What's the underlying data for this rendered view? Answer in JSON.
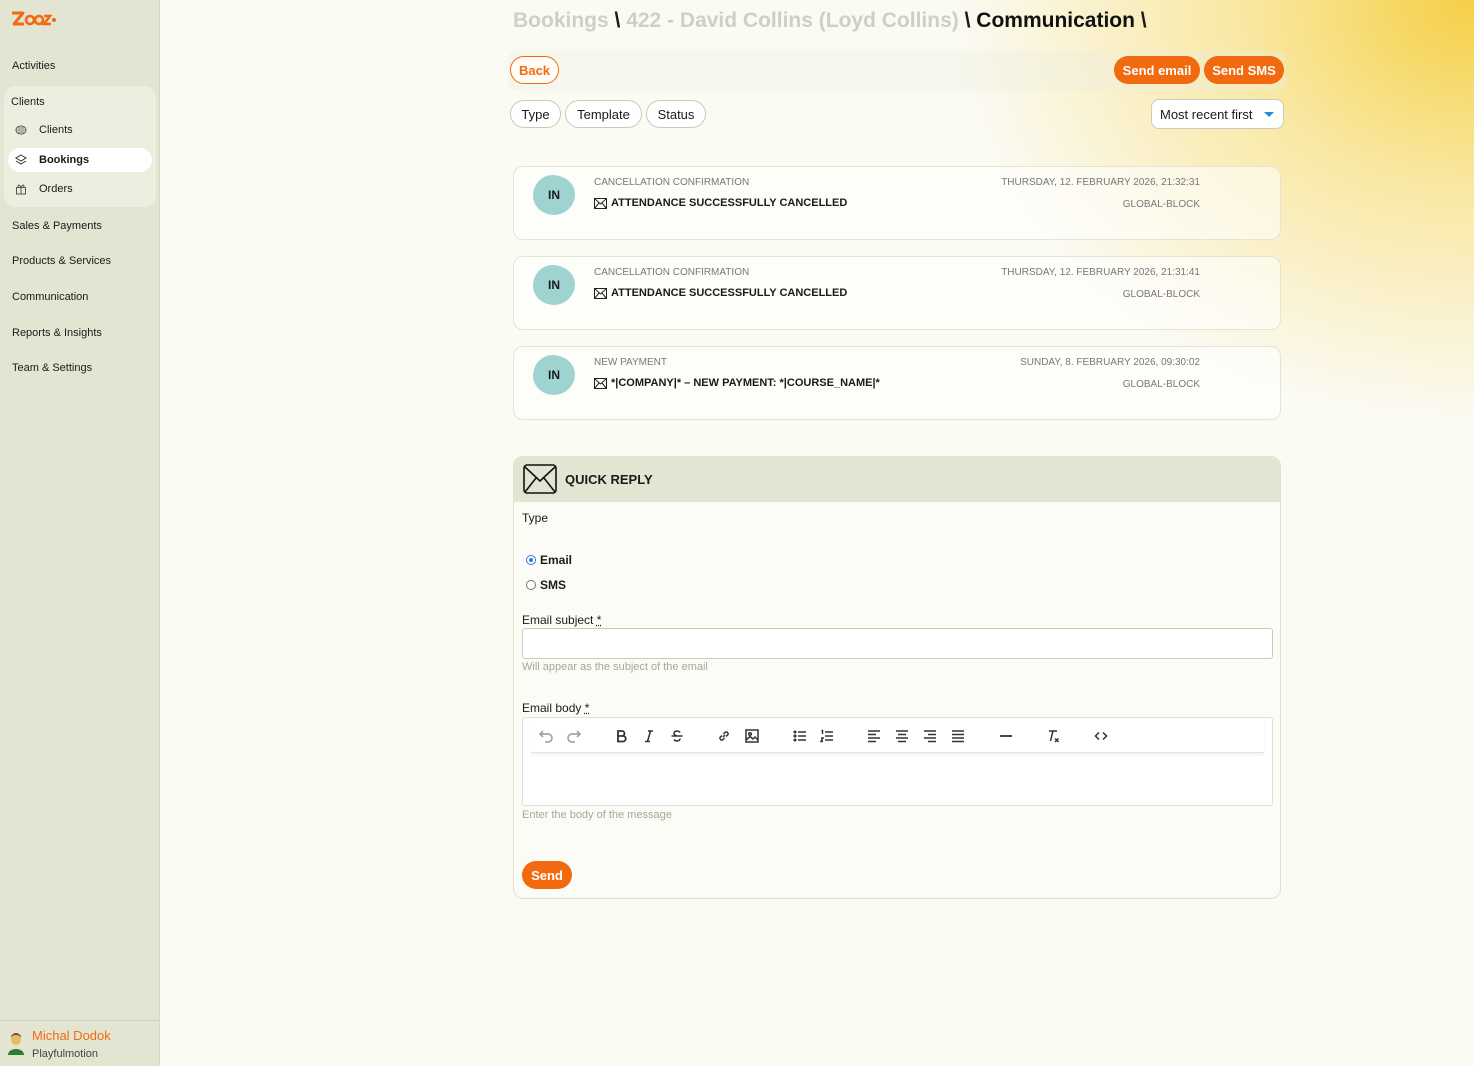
{
  "sidebar": {
    "logo_text": "Zooza",
    "nav": {
      "activities": "Activities",
      "clients_group": "Clients",
      "sub_clients": "Clients",
      "sub_bookings": "Bookings",
      "sub_orders": "Orders",
      "sales": "Sales & Payments",
      "products": "Products & Services",
      "communication": "Communication",
      "reports": "Reports & Insights",
      "team": "Team & Settings"
    },
    "user": {
      "name": "Michal Dodok",
      "org": "Playfulmotion"
    }
  },
  "breadcrumb": {
    "level1": "Bookings",
    "level2": "422 - David Collins (Loyd Collins)",
    "current": "Communication",
    "separator": "\\"
  },
  "actions": {
    "back": "Back",
    "send_email": "Send email",
    "send_sms": "Send SMS"
  },
  "filters": {
    "type": "Type",
    "template": "Template",
    "status": "Status",
    "sort": "Most recent first"
  },
  "messages": [
    {
      "badge": "IN",
      "type": "Cancellation confirmation",
      "subject": "Attendance successfully cancelled",
      "date": "Thursday, 12. February 2026, 21:32:31",
      "sender": "global-block"
    },
    {
      "badge": "IN",
      "type": "Cancellation confirmation",
      "subject": "Attendance successfully cancelled",
      "date": "Thursday, 12. February 2026, 21:31:41",
      "sender": "global-block"
    },
    {
      "badge": "IN",
      "type": "New payment",
      "subject": "*|COMPANY|* – New payment: *|COURSE_NAME|*",
      "date": "Sunday, 8. February 2026, 09:30:02",
      "sender": "global-block"
    }
  ],
  "quick_reply": {
    "title": "QUICK REPLY",
    "type_label": "Type",
    "options": {
      "email": "Email",
      "sms": "SMS"
    },
    "selected": "email",
    "subject_label": "Email subject",
    "subject_value": "",
    "subject_hint": "Will appear as the subject of the email",
    "body_label": "Email body",
    "body_hint": "Enter the body of the message",
    "required_mark": "*",
    "send": "Send"
  },
  "colors": {
    "accent": "#f26a10",
    "sidebar": "#e3e5d2",
    "badge": "#9fd3d0"
  }
}
